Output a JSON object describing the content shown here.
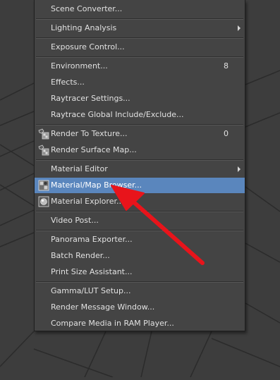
{
  "menu": {
    "items": [
      {
        "label": "Scene Converter..."
      },
      {
        "label": "Lighting Analysis",
        "submenu": true
      },
      {
        "label": "Exposure Control..."
      },
      {
        "label": "Environment...",
        "shortcut": "8"
      },
      {
        "label": "Effects..."
      },
      {
        "label": "Raytracer Settings..."
      },
      {
        "label": "Raytrace Global Include/Exclude..."
      },
      {
        "label": "Render To Texture...",
        "shortcut": "0",
        "icon": "render-to-texture-icon"
      },
      {
        "label": "Render Surface Map...",
        "icon": "render-surface-map-icon"
      },
      {
        "label": "Material Editor",
        "submenu": true
      },
      {
        "label": "Material/Map Browser...",
        "icon": "material-map-browser-icon",
        "highlighted": true
      },
      {
        "label": "Material Explorer...",
        "icon": "material-explorer-icon"
      },
      {
        "label": "Video Post..."
      },
      {
        "label": "Panorama Exporter..."
      },
      {
        "label": "Batch Render..."
      },
      {
        "label": "Print Size Assistant..."
      },
      {
        "label": "Gamma/LUT Setup..."
      },
      {
        "label": "Render Message Window..."
      },
      {
        "label": "Compare Media in RAM Player..."
      }
    ]
  },
  "annotation": {
    "color": "#e8141b",
    "points_to": "Material/Map Browser..."
  },
  "colors": {
    "highlight": "#5a86bd",
    "menu_bg": "#444444",
    "background": "#3d3d3d"
  }
}
